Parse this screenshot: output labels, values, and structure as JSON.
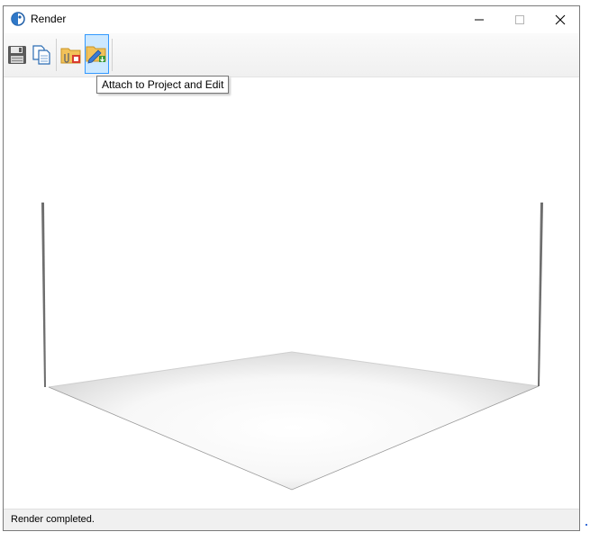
{
  "window": {
    "title": "Render",
    "controls": {
      "minimize": "minimize-icon",
      "maximize": "maximize-icon",
      "close": "close-icon"
    }
  },
  "toolbar": {
    "buttons": [
      {
        "name": "save",
        "icon": "floppy-disk-icon"
      },
      {
        "name": "copy",
        "icon": "copy-pages-icon"
      },
      {
        "name": "attach-to-project",
        "icon": "folder-attach-icon"
      },
      {
        "name": "attach-to-project-and-edit",
        "icon": "folder-edit-icon",
        "state": "hovered"
      }
    ]
  },
  "tooltip": {
    "text": "Attach to Project and Edit"
  },
  "status": {
    "text": "Render completed."
  },
  "colors": {
    "hover_fill": "#cce8ff",
    "hover_border": "#3399ff",
    "statusbar": "#f0f0f0"
  }
}
